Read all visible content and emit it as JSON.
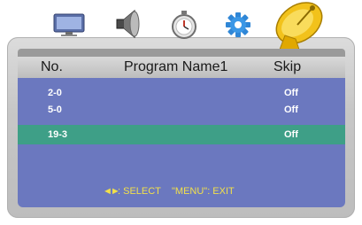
{
  "toolbar": {
    "icons": [
      "monitor-icon",
      "speaker-icon",
      "timer-icon",
      "gear-icon",
      "satellite-dish-icon"
    ],
    "active_icon": "satellite-dish-icon"
  },
  "table": {
    "columns": [
      "No.",
      "Program Name1",
      "Skip"
    ],
    "rows": [
      {
        "number": "2-0",
        "skip": "Off",
        "selected": false
      },
      {
        "number": "5-0",
        "skip": "Off",
        "selected": false
      },
      {
        "number": "19-3",
        "skip": "Off",
        "selected": true
      }
    ]
  },
  "footer": {
    "arrows": "◄►",
    "select_hint": ": SELECT",
    "exit_hint": "\"MENU\": EXIT"
  },
  "colors": {
    "panel": "#6b78bf",
    "selected_row": "#3e9f87",
    "hint_text": "#f2e04a"
  }
}
